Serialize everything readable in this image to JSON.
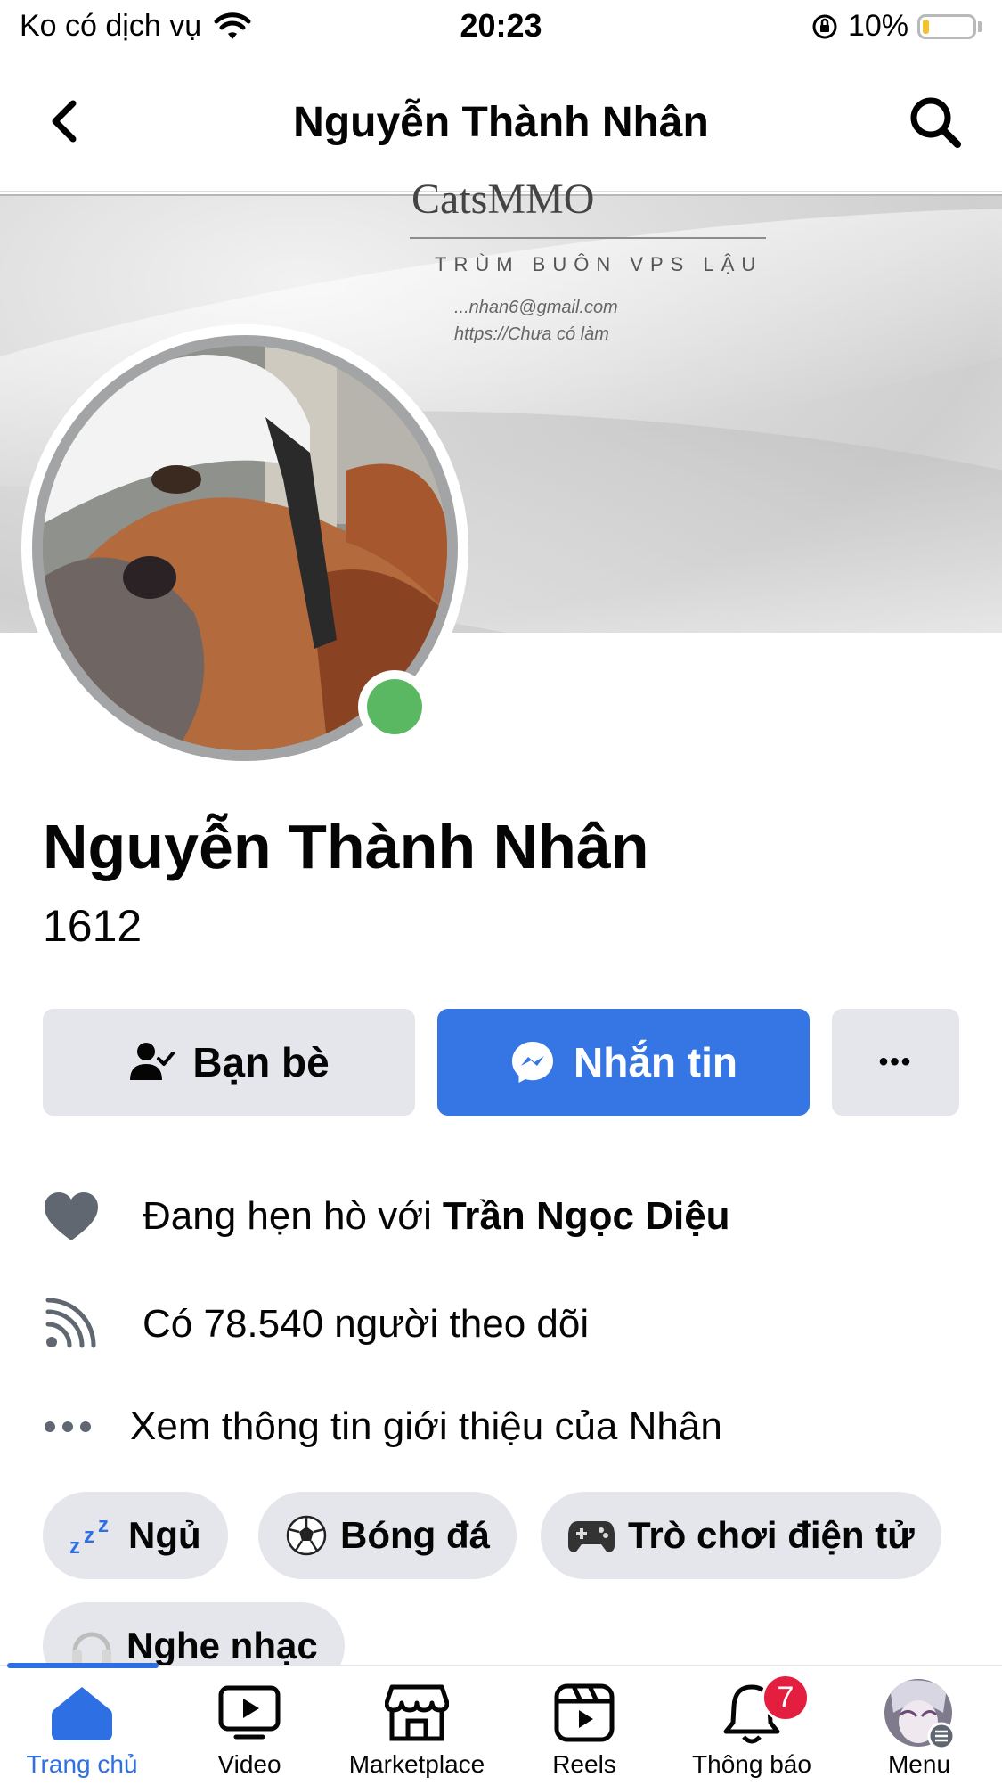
{
  "status_bar": {
    "carrier": "Ko có dịch vụ",
    "time": "20:23",
    "battery_percent": "10%",
    "battery_level": 0.1
  },
  "header": {
    "title": "Nguyễn Thành Nhân",
    "back_icon": "chevron-left-icon",
    "search_icon": "search-icon"
  },
  "cover": {
    "brand": "CatsMMO",
    "tagline": "TRÙM BUÔN VPS LẬU",
    "email": "...nhan6@gmail.com",
    "website": "https://Chưa có làm"
  },
  "profile": {
    "name": "Nguyễn Thành Nhân",
    "subtitle": "1612",
    "online": true
  },
  "actions": {
    "friends_label": "Bạn bè",
    "message_label": "Nhắn tin",
    "more_label": "•••"
  },
  "details": {
    "relationship_prefix": "Đang hẹn hò với",
    "relationship_partner": "Trần Ngọc Diệu",
    "followers": "Có 78.540 người theo dõi",
    "see_about": "Xem thông tin giới thiệu của Nhân"
  },
  "hobbies": [
    {
      "emoji": "zᶻᶻ",
      "label": "Ngủ"
    },
    {
      "emoji": "⚽",
      "label": "Bóng đá"
    },
    {
      "emoji": "🎮",
      "label": "Trò chơi điện tử"
    },
    {
      "emoji": "🎧",
      "label": "Nghe nhạc"
    }
  ],
  "tabbar": {
    "tabs": [
      {
        "label": "Trang chủ",
        "icon": "home-icon",
        "active": true
      },
      {
        "label": "Video",
        "icon": "video-icon"
      },
      {
        "label": "Marketplace",
        "icon": "marketplace-icon"
      },
      {
        "label": "Reels",
        "icon": "reels-icon"
      },
      {
        "label": "Thông báo",
        "icon": "bell-icon",
        "badge": "7"
      },
      {
        "label": "Menu",
        "icon": "avatar-menu-icon"
      }
    ]
  },
  "colors": {
    "accent": "#3575e4",
    "active_tab": "#2f6fe4",
    "online": "#5ab862",
    "badge": "#e41e3f"
  }
}
